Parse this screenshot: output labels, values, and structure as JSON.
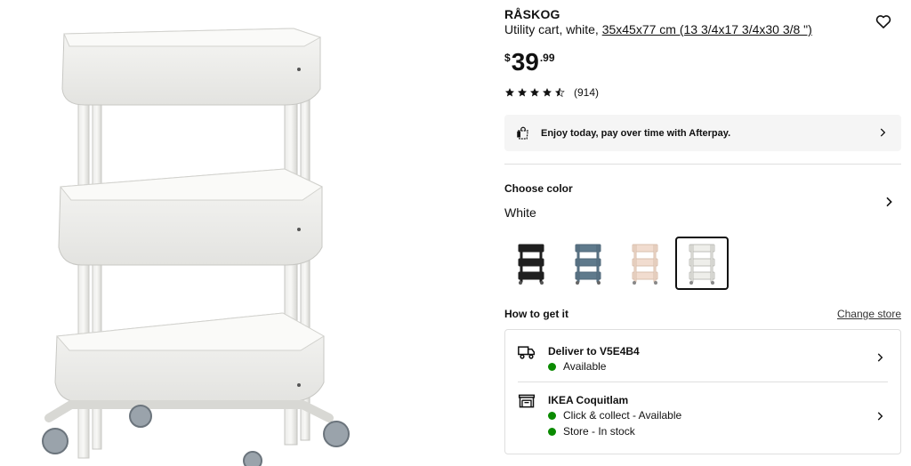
{
  "product": {
    "name": "RÅSKOG",
    "description_prefix": "Utility cart, white, ",
    "dimensions": "35x45x77 cm (13 3/4x17 3/4x30 3/8 \")",
    "price": {
      "currency": "$",
      "integer": "39",
      "decimal": ".99"
    },
    "rating": {
      "stars": 4.5,
      "count": "(914)"
    }
  },
  "afterpay": {
    "text": "Enjoy today, pay over time with Afterpay."
  },
  "color": {
    "title": "Choose color",
    "value": "White",
    "options": [
      {
        "name": "Black",
        "hex": "#1f1f1f",
        "selected": false
      },
      {
        "name": "Blue",
        "hex": "#5f7a8c",
        "selected": false
      },
      {
        "name": "Pink",
        "hex": "#ecd5c6",
        "selected": false
      },
      {
        "name": "White",
        "hex": "#e8e8e4",
        "selected": true
      }
    ]
  },
  "fulfillment": {
    "title": "How to get it",
    "change_store": "Change store",
    "delivery": {
      "title": "Deliver to V5E4B4",
      "status": "Available"
    },
    "store": {
      "title": "IKEA Coquitlam",
      "status_1": "Click & collect - Available",
      "status_2": "Store - In stock"
    }
  },
  "colors": {
    "available": "#0a8a00",
    "text": "#111111",
    "afterpay_bg": "#f5f5f5",
    "divider": "#dfdfdf"
  }
}
